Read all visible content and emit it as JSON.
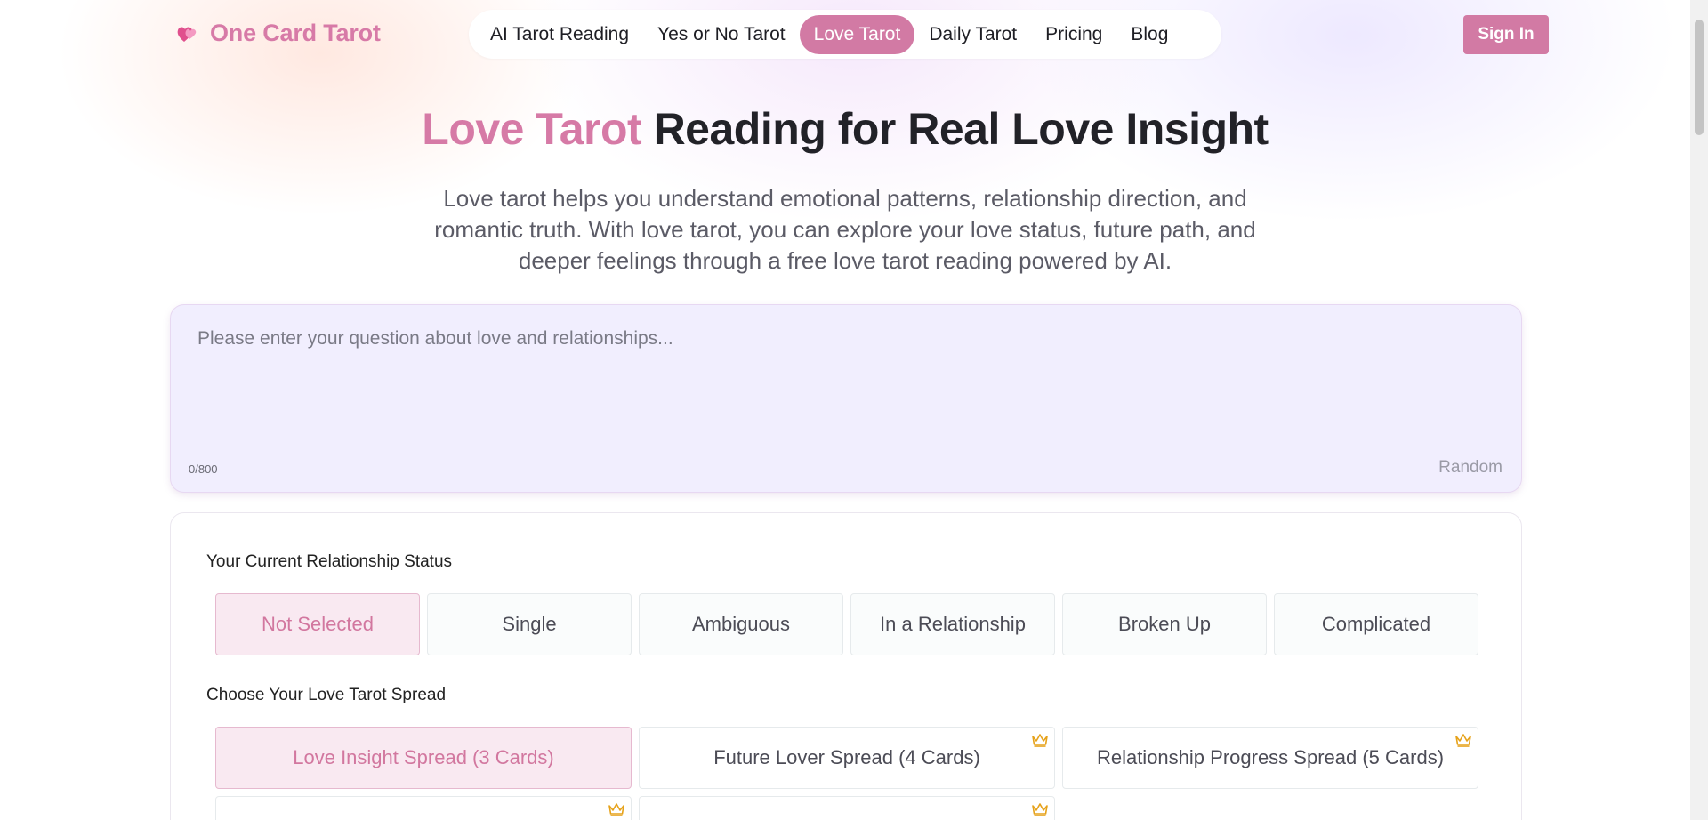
{
  "header": {
    "logo_text": "One Card Tarot",
    "logo_icon": "hearts-icon",
    "nav": [
      {
        "label": "AI Tarot Reading",
        "active": false
      },
      {
        "label": "Yes or No Tarot",
        "active": false
      },
      {
        "label": "Love Tarot",
        "active": true
      },
      {
        "label": "Daily Tarot",
        "active": false
      },
      {
        "label": "Pricing",
        "active": false
      },
      {
        "label": "Blog",
        "active": false
      }
    ],
    "signin_label": "Sign In"
  },
  "hero": {
    "title_accent": "Love Tarot",
    "title_rest": " Reading for Real Love Insight",
    "description": "Love tarot helps you understand emotional patterns, relationship direction, and romantic truth. With love tarot, you can explore your love status, future path, and deeper feelings through a free love tarot reading powered by AI."
  },
  "question": {
    "placeholder": "Please enter your question about love and relationships...",
    "value": "",
    "char_count": "0/800",
    "random_label": "Random"
  },
  "status": {
    "label": "Your Current Relationship Status",
    "options": [
      "Not Selected",
      "Single",
      "Ambiguous",
      "In a Relationship",
      "Broken Up",
      "Complicated"
    ],
    "selected": "Not Selected"
  },
  "spread": {
    "label": "Choose Your Love Tarot Spread",
    "options": [
      {
        "label": "Love Insight Spread (3 Cards)",
        "premium": false,
        "selected": true
      },
      {
        "label": "Future Lover Spread (4 Cards)",
        "premium": true,
        "selected": false
      },
      {
        "label": "Relationship Progress Spread (5 Cards)",
        "premium": true,
        "selected": false
      },
      {
        "label": "",
        "premium": true,
        "selected": false
      },
      {
        "label": "",
        "premium": true,
        "selected": false
      }
    ]
  },
  "colors": {
    "accent": "#d27aa4",
    "question_bg": "#f1eefe",
    "selected_bg": "#f9e9f1",
    "crown": "#e6a21a"
  }
}
